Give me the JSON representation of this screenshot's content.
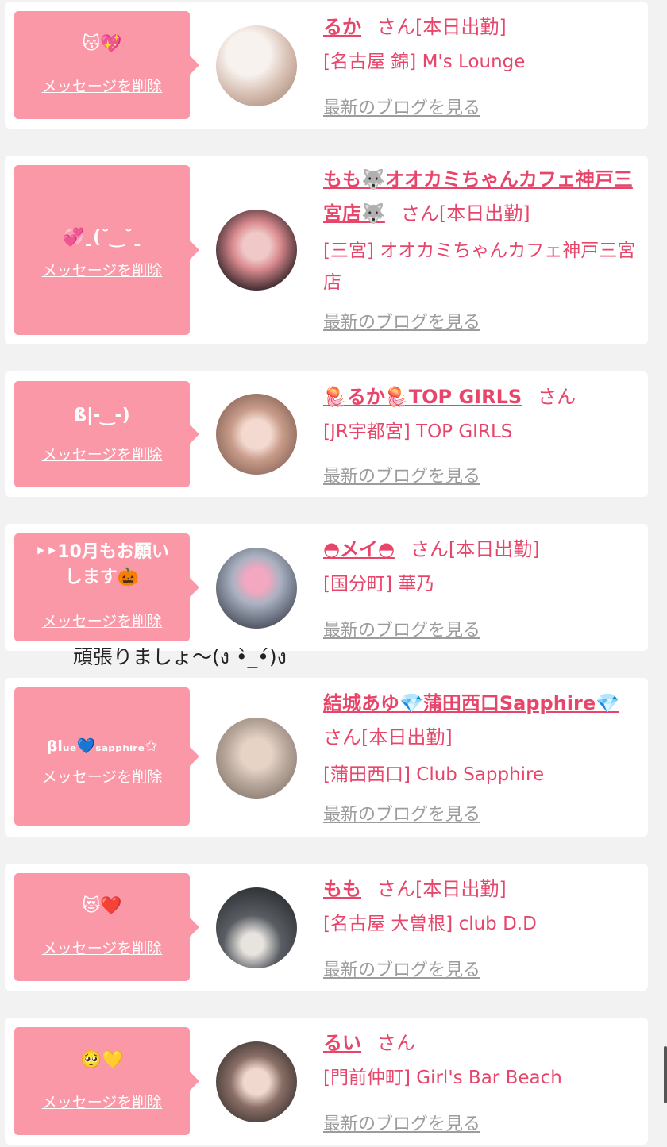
{
  "delete_label": "メッセージを削除",
  "san_label": "さん",
  "blog_label": "最新のブログを見る",
  "items": [
    {
      "message": "😽💖",
      "name": "るか",
      "status": "[本日出勤]",
      "shop": "[名古屋 錦] M's Lounge",
      "avatar_color": "#e9dcd6"
    },
    {
      "message": "💞ˍ(˘‿˘ˍ",
      "name": "もも🐺オオカミちゃんカフェ神戸三宮店🐺",
      "status": "[本日出勤]",
      "shop": "[三宮] オオカミちゃんカフェ神戸三宮店",
      "avatar_color": "#3b2a2e"
    },
    {
      "message": "ß|-‿-)",
      "name": "🪼るか🪼TOP GIRLS",
      "status": "",
      "shop": "[JR宇都宮] TOP GIRLS",
      "avatar_color": "#8a6a5e"
    },
    {
      "message": "‣‣10月もお願いします🎃",
      "name": "◓メイ◓",
      "status": "[本日出勤]",
      "shop": "[国分町] 華乃",
      "avatar_color": "#4a4f5c"
    },
    {
      "message": "βlᵤₑ💙ₛₐₚₚₕᵢᵣₑ✩",
      "name": "結城あゆ💎蒲田西口Sapphire💎",
      "status": "[本日出勤]",
      "shop": "[蒲田西口] Club Sapphire",
      "avatar_color": "#b9a89c"
    },
    {
      "message": "😻❤️",
      "name": "もも",
      "status": "[本日出勤]",
      "shop": "[名古屋 大曽根] club D.D",
      "avatar_color": "#2f3236"
    },
    {
      "message": "🥺💛",
      "name": "るい",
      "status": "",
      "shop": "[門前仲町] Girl's Bar Beach",
      "avatar_color": "#3a3230"
    }
  ],
  "overflow_text": "頑張りましょ〜(ง •̀_•́)ง"
}
